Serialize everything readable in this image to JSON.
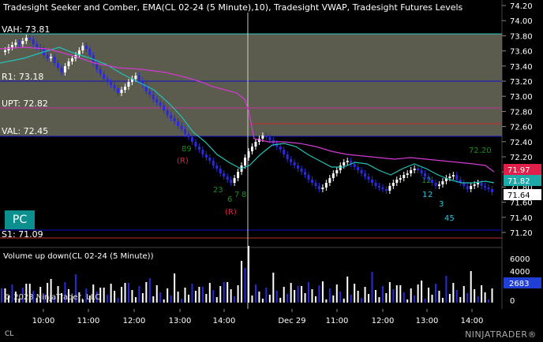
{
  "price_panel": {
    "title": "Tradesight Seeker and Comber, EMA(CL 02-24 (5 Minute),10), Tradesight VWAP, Tradesight Futures Levels"
  },
  "volume_panel": {
    "title": "Volume up down(CL 02-24 (5 Minute))"
  },
  "pc_button_label": "PC",
  "copyright": "© 2023 NinjaTrader, LLC",
  "instrument_short": "CL",
  "logo_text": "NINJATRADER®",
  "level_labels": {
    "vah": "VAH: 73.81",
    "r1": "R1: 73.18",
    "upt": "UPT: 72.82",
    "val": "VAL: 72.45",
    "s1": "S1: 71.09"
  },
  "price_axis": {
    "ticks": [
      "74.20",
      "74.00",
      "73.80",
      "73.60",
      "73.40",
      "73.20",
      "73.00",
      "72.80",
      "72.60",
      "72.40",
      "72.20",
      "72.00",
      "71.80",
      "71.60",
      "71.40",
      "71.20"
    ],
    "badges": [
      {
        "text": "71.97",
        "color": "#e0204a"
      },
      {
        "text": "71.82",
        "color": "#1fa8a8"
      },
      {
        "text": "71.64",
        "color": "#ffffff"
      }
    ]
  },
  "volume_axis": {
    "ticks": [
      "6000",
      "4000",
      "2000",
      "0"
    ],
    "badge": {
      "text": "2683",
      "color": "#1f3fd6"
    }
  },
  "time_axis": {
    "labels": [
      "10:00",
      "11:00",
      "12:00",
      "13:00",
      "14:00",
      "Dec 29",
      "11:00",
      "12:00",
      "13:00",
      "14:00"
    ]
  },
  "annotations": {
    "r1": "(R)",
    "r2": "(R)",
    "c_7220": "72.20",
    "s23": "23",
    "s6": "6",
    "s7": "7",
    "s8": "8",
    "c1": "1",
    "c2": "2",
    "c3": "3",
    "c5": "5",
    "c45": "45",
    "g89": "89",
    "g12": "12"
  },
  "colors": {
    "up_bar": "#ffffff",
    "down_bar": "#2a2adc",
    "ema": "#22c2b8",
    "vwap": "#d23bd2",
    "value_area": "#6b6b5c",
    "level_line": "#1010c8",
    "r_signal": "#e0204a",
    "seeker": "#1c8c1c",
    "comber": "#22c8e0"
  }
}
